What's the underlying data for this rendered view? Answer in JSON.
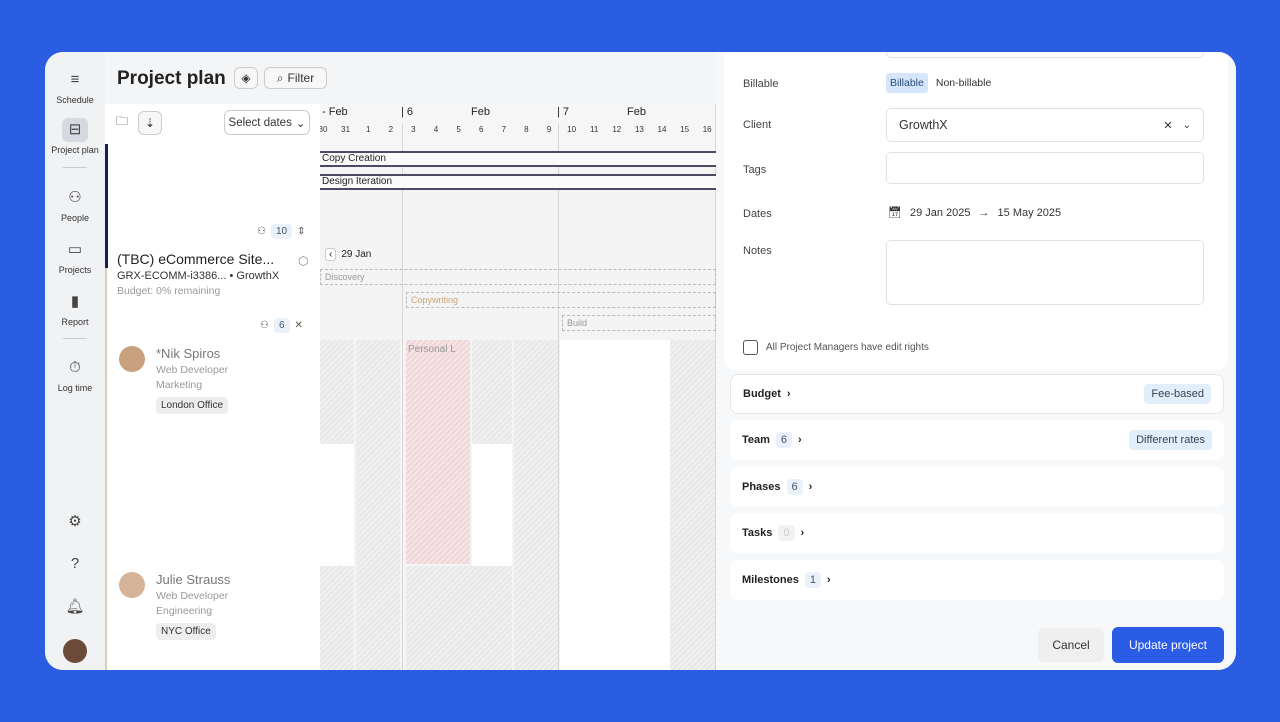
{
  "sidebar": {
    "items": [
      {
        "label": "Schedule",
        "icon": "schedule-icon"
      },
      {
        "label": "Project plan",
        "icon": "project-plan-icon"
      },
      {
        "label": "People",
        "icon": "people-icon"
      },
      {
        "label": "Projects",
        "icon": "folder-icon"
      },
      {
        "label": "Report",
        "icon": "bar-chart-icon"
      },
      {
        "label": "Log time",
        "icon": "timer-icon"
      }
    ]
  },
  "header": {
    "title": "Project plan",
    "filter_label": "Filter"
  },
  "left": {
    "select_dates": "Select dates",
    "group_count": "10",
    "project": {
      "name": "(TBC) eCommerce Site...",
      "code": "GRX-ECOMM-i3386...",
      "client": "GrowthX",
      "budget": "Budget: 0% remaining"
    },
    "team_count": "6",
    "people": [
      {
        "name": "*Nik Spiros",
        "role": "Web Developer",
        "dept": "Marketing",
        "office": "London Office"
      },
      {
        "name": "Julie Strauss",
        "role": "Web Developer",
        "dept": "Engineering",
        "office": "NYC Office"
      }
    ]
  },
  "timeline": {
    "weeks": [
      {
        "num": "",
        "month": "- Feb"
      },
      {
        "num": "6",
        "month": "Feb"
      },
      {
        "num": "7",
        "month": "Feb"
      }
    ],
    "days": [
      "30",
      "31",
      "1",
      "2",
      "3",
      "4",
      "5",
      "6",
      "7",
      "8",
      "9",
      "10",
      "11",
      "12",
      "13",
      "14",
      "15",
      "16"
    ],
    "bars": [
      "Copy Creation",
      "Design Iteration"
    ],
    "back_date": "29 Jan",
    "phases": [
      "Discovery",
      "Copywriting",
      "Build"
    ],
    "leave": "Personal L"
  },
  "form": {
    "billable_label": "Billable",
    "billable_options": [
      "Billable",
      "Non-billable"
    ],
    "client_label": "Client",
    "client_value": "GrowthX",
    "tags_label": "Tags",
    "dates_label": "Dates",
    "start_date": "29 Jan 2025",
    "end_date": "15 May 2025",
    "notes_label": "Notes",
    "pm_rights": "All Project Managers have edit rights"
  },
  "sections": [
    {
      "label": "Budget",
      "count": null,
      "tag": "Fee-based"
    },
    {
      "label": "Team",
      "count": "6",
      "tag": "Different rates"
    },
    {
      "label": "Phases",
      "count": "6",
      "tag": null
    },
    {
      "label": "Tasks",
      "count": "0",
      "tag": null
    },
    {
      "label": "Milestones",
      "count": "1",
      "tag": null
    }
  ],
  "footer": {
    "cancel": "Cancel",
    "update": "Update project"
  },
  "colors": {
    "accent": "#2a5ce6",
    "bar_border": "#4a4a63"
  }
}
